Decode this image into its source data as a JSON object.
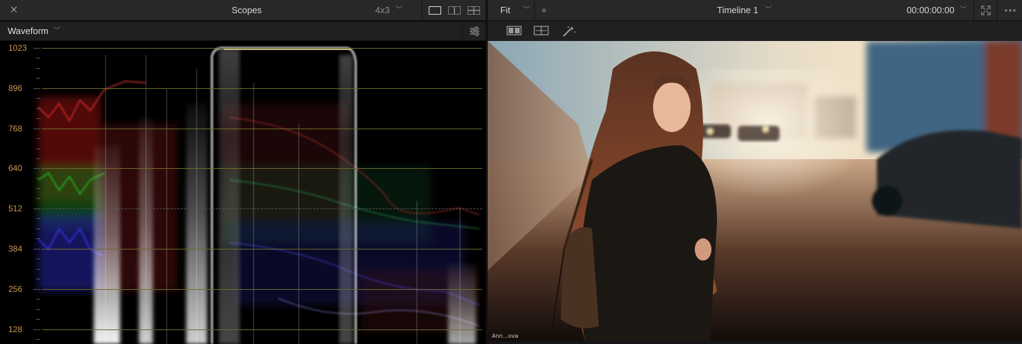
{
  "scopes_panel": {
    "title": "Scopes",
    "aspect_ratio": "4x3",
    "scope_type": "Waveform",
    "y_axis_labels": [
      "1023",
      "896",
      "768",
      "640",
      "512",
      "384",
      "256",
      "128"
    ],
    "graticule_color": "#6d6a2a",
    "label_color": "#c89a55"
  },
  "viewer": {
    "zoom": "Fit",
    "timeline": "Timeline 1",
    "timecode": "00:00:00:00",
    "watermark": "Ann...ova"
  },
  "icons": {
    "close": "close-icon",
    "settings": "sliders-icon",
    "expand": "expand-icon",
    "more": "more-icon",
    "magic": "magic-wand-icon"
  },
  "colors": {
    "panel_bg": "#28282b",
    "accent_text": "#d8d8d8",
    "background": "#000000"
  }
}
